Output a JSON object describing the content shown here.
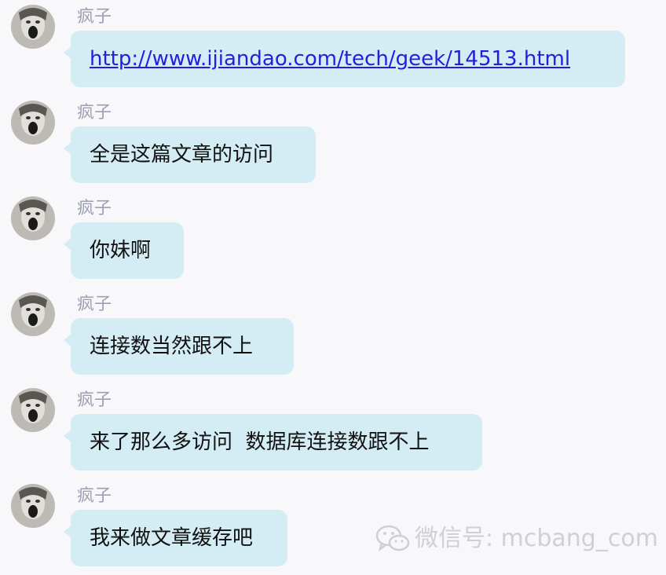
{
  "messages": [
    {
      "sender": "疯子",
      "text": "http://www.ijiandao.com/tech/geek/14513.html",
      "is_link": true
    },
    {
      "sender": "疯子",
      "text": "全是这篇文章的访问",
      "is_link": false
    },
    {
      "sender": "疯子",
      "text": "你妹啊",
      "is_link": false
    },
    {
      "sender": "疯子",
      "text": "连接数当然跟不上",
      "is_link": false
    },
    {
      "sender": "疯子",
      "text": "来了那么多访问  数据库连接数跟不上",
      "is_link": false
    },
    {
      "sender": "疯子",
      "text": "我来做文章缓存吧",
      "is_link": false
    }
  ],
  "watermark": {
    "text": "微信号: mcbang_com",
    "icon": "wechat-icon"
  },
  "colors": {
    "background": "#f8f8fa",
    "bubble": "#d4ecf4",
    "sender": "#9d9fb3",
    "link": "#1f1fe0",
    "watermark": "#cfd0d4"
  }
}
